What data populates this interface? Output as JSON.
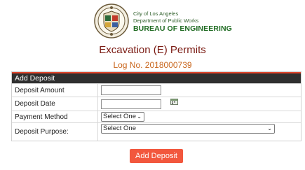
{
  "agency": {
    "line1": "City of Los Angeles",
    "line2": "Department of Public Works",
    "line3": "BUREAU OF ENGINEERING"
  },
  "page": {
    "title": "Excavation (E) Permits",
    "log_number": "Log No. 2018000739"
  },
  "form": {
    "header": "Add Deposit",
    "fields": {
      "deposit_amount": {
        "label": "Deposit Amount",
        "value": ""
      },
      "deposit_date": {
        "label": "Deposit Date",
        "value": ""
      },
      "payment_method": {
        "label": "Payment Method",
        "selected": "Select One"
      },
      "deposit_purpose": {
        "label": "Deposit Purpose:",
        "selected": "Select One"
      }
    },
    "submit_label": "Add Deposit"
  },
  "colors": {
    "title": "#7a1a12",
    "log_number": "#c8641a",
    "panel_header": "#2f2f2f",
    "accent": "#e0452b",
    "button": "#f2573d",
    "agency_green": "#1f6b22"
  },
  "icons": {
    "seal": "city-seal-icon",
    "calendar": "calendar-icon",
    "dropdown": "chevron-down-icon"
  }
}
